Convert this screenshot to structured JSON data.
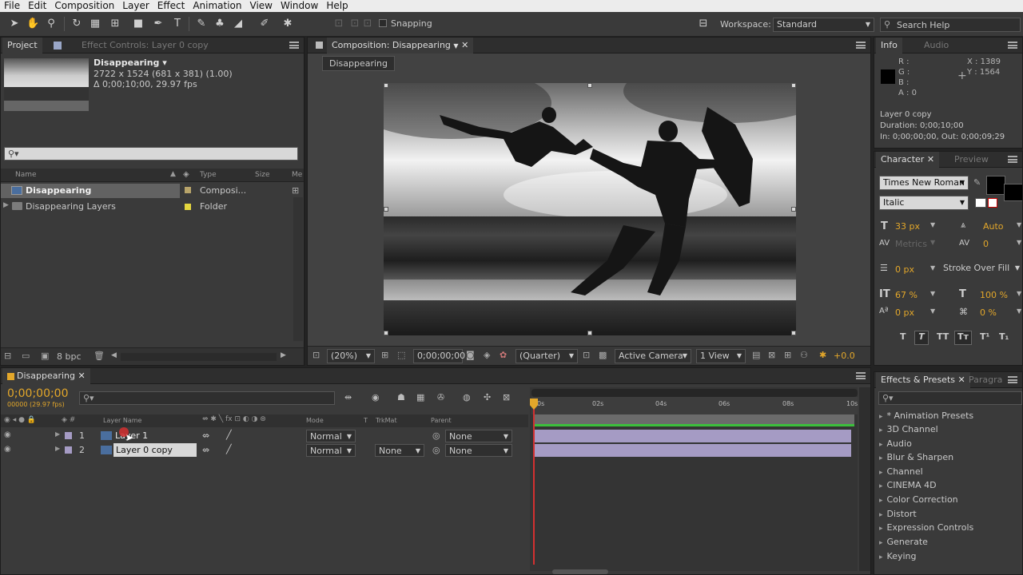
{
  "menubar": [
    "File",
    "Edit",
    "Composition",
    "Layer",
    "Effect",
    "Animation",
    "View",
    "Window",
    "Help"
  ],
  "toolbar": {
    "snapping": "Snapping",
    "workspace_label": "Workspace:",
    "workspace_value": "Standard",
    "search_placeholder": "Search Help"
  },
  "project": {
    "tab_project": "Project",
    "tab_effect_controls": "Effect Controls: Layer 0 copy",
    "item_title": "Disappearing ▾",
    "item_dims": "2722 x 1524  (681 x 381) (1.00)",
    "item_duration": "Δ 0;00;10;00, 29.97 fps",
    "col_name": "Name",
    "col_type": "Type",
    "col_size": "Size",
    "col_media": "Me",
    "rows": [
      {
        "name": "Disappearing",
        "type": "Composi...",
        "color": "#b8a46a"
      },
      {
        "name": "Disappearing Layers",
        "type": "Folder",
        "color": "#e4d63e"
      }
    ],
    "bpc": "8 bpc"
  },
  "composition": {
    "tab": "Composition: Disappearing",
    "crumb": "Disappearing",
    "zoom": "(20%)",
    "timecode": "0;00;00;00",
    "resolution": "(Quarter)",
    "camera": "Active Camera",
    "view": "1 View",
    "exposure": "+0.0"
  },
  "info": {
    "tab_info": "Info",
    "tab_audio": "Audio",
    "r": "R :",
    "g": "G :",
    "b": "B :",
    "a": "A : 0",
    "x": "X : 1389",
    "y": "Y : 1564",
    "layer": "Layer 0 copy",
    "duration": "Duration: 0;00;10;00",
    "inout": "In: 0;00;00;00, Out: 0;00;09;29"
  },
  "character": {
    "tab_character": "Character",
    "tab_preview": "Preview",
    "font": "Times New Roman",
    "style": "Italic",
    "size": "33 px",
    "leading": "Auto",
    "kerning": "Metrics",
    "tracking": "0",
    "stroke_width": "0 px",
    "stroke_mode": "Stroke Over Fill",
    "vscale": "67 %",
    "hscale": "100 %",
    "baseline": "0 px",
    "tsume": "0 %"
  },
  "timeline": {
    "tab": "Disappearing",
    "timecode": "0;00;00;00",
    "fps": "00000 (29.97 fps)",
    "col_layer_name": "Layer Name",
    "col_mode": "Mode",
    "col_t": "T",
    "col_trkmat": "TrkMat",
    "col_parent": "Parent",
    "ruler": [
      "0s",
      "02s",
      "04s",
      "06s",
      "08s",
      "10s"
    ],
    "layers": [
      {
        "num": "1",
        "name": "Layer 1",
        "mode": "Normal",
        "trkmat": "",
        "parent": "None"
      },
      {
        "num": "2",
        "name": "Layer 0 copy",
        "mode": "Normal",
        "trkmat": "None",
        "parent": "None"
      }
    ]
  },
  "effects": {
    "tab_effects": "Effects & Presets",
    "tab_paragraph": "Paragra",
    "items": [
      "* Animation Presets",
      "3D Channel",
      "Audio",
      "Blur & Sharpen",
      "Channel",
      "CINEMA 4D",
      "Color Correction",
      "Distort",
      "Expression Controls",
      "Generate",
      "Keying"
    ]
  },
  "colors": {
    "accent_timecode": "#e3a72a",
    "layer_bar": "#a59bc4",
    "work_area": "#3cbf3c",
    "cti": "#d43030"
  }
}
